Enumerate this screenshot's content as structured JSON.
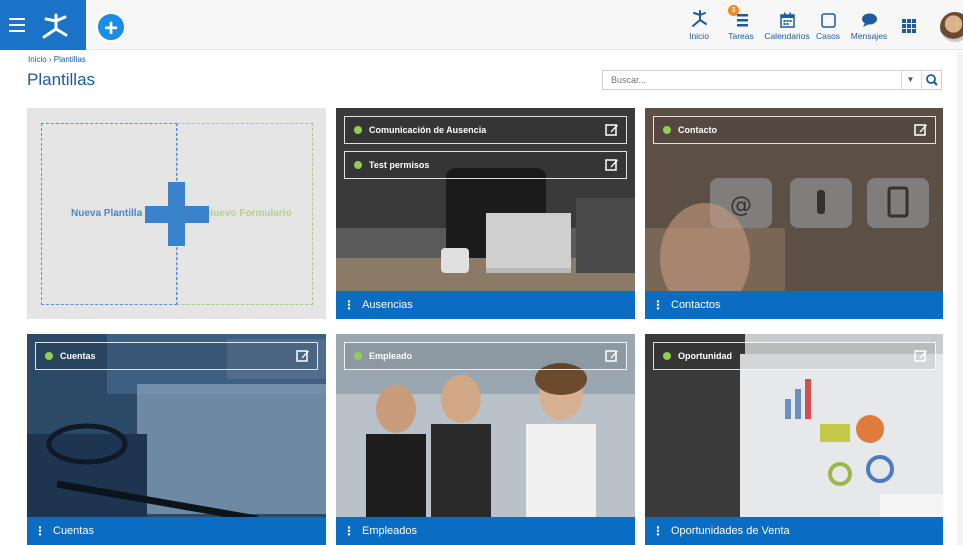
{
  "topbar": {
    "add_label": "+",
    "nav": [
      {
        "label": "Inicio",
        "icon": "home-tree-icon"
      },
      {
        "label": "Tareas",
        "icon": "tasks-icon",
        "badge": "3"
      },
      {
        "label": "Calendarios",
        "icon": "calendar-icon"
      },
      {
        "label": "Casos",
        "icon": "case-icon"
      },
      {
        "label": "Mensajes",
        "icon": "message-icon"
      }
    ],
    "apps_icon": "apps-grid-icon"
  },
  "breadcrumb": "Inicio › Plantillas",
  "page_title": "Plantillas",
  "search": {
    "placeholder": "Buscar...",
    "value": ""
  },
  "new_card": {
    "left_label": "Nueva Plantilla",
    "right_label": "Nuevo Formulario"
  },
  "cards": [
    {
      "footer": "Ausencias",
      "templates": [
        "Comunicación de Ausencia",
        "Test permisos"
      ]
    },
    {
      "footer": "Contactos",
      "templates": [
        "Contacto"
      ]
    },
    {
      "footer": "Cuentas",
      "templates": [
        "Cuentas"
      ]
    },
    {
      "footer": "Empleados",
      "templates": [
        "Empleado"
      ]
    },
    {
      "footer": "Oportunidades de Venta",
      "templates": [
        "Oportunidad"
      ]
    }
  ],
  "colors": {
    "primary": "#0b6cc4",
    "brand": "#1a73c7",
    "status_dot": "#8fd14f",
    "badge": "#f2891a"
  }
}
